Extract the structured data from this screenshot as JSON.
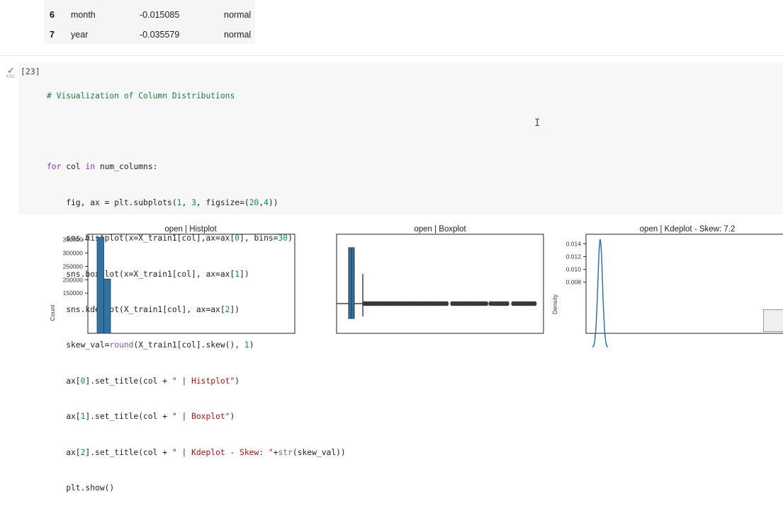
{
  "table": {
    "rows": [
      {
        "index": "6",
        "column": "month",
        "skew": "-0.015085",
        "distribution": "normal"
      },
      {
        "index": "7",
        "column": "year",
        "skew": "-0.035579",
        "distribution": "normal"
      }
    ]
  },
  "cell": {
    "execution_count": "[23]",
    "run_time": "43s",
    "comment": "# Visualization of Column Distributions",
    "code_lines": [
      "for col in num_columns:",
      "    fig, ax = plt.subplots(1, 3, figsize=(20,4))",
      "    sns.histplot(x=X_train1[col],ax=ax[0], bins=30)",
      "    sns.boxplot(x=X_train1[col], ax=ax[1])",
      "    sns.kdeplot(X_train1[col], ax=ax[2])",
      "    skew_val=round(X_train1[col].skew(), 1)",
      "    ax[0].set_title(col + \" | Histplot\")",
      "    ax[1].set_title(col + \" | Boxplot\")",
      "    ax[2].set_title(col + \" | Kdeplot - Skew: \"+str(skew_val))",
      "    plt.show()"
    ]
  },
  "colors": {
    "bar": "#3274a1",
    "comment": "#1a7f37",
    "keyword": "#8f2fbf",
    "string": "#a31515"
  },
  "chart_data": [
    {
      "type": "bar",
      "title": "open | Histplot",
      "ylabel": "Count",
      "yticks": [
        "350000",
        "300000",
        "250000",
        "200000",
        "150000"
      ],
      "ylim": [
        0,
        370000
      ],
      "values": [
        358000,
        203000
      ]
    },
    {
      "type": "box",
      "title": "open | Boxplot"
    },
    {
      "type": "line",
      "title": "open | Kdeplot - Skew: 7.2",
      "ylabel": "Density",
      "yticks": [
        "0.014",
        "0.012",
        "0.010",
        "0.008"
      ],
      "ylim": [
        0,
        0.0155
      ],
      "peak": 0.0147
    }
  ]
}
